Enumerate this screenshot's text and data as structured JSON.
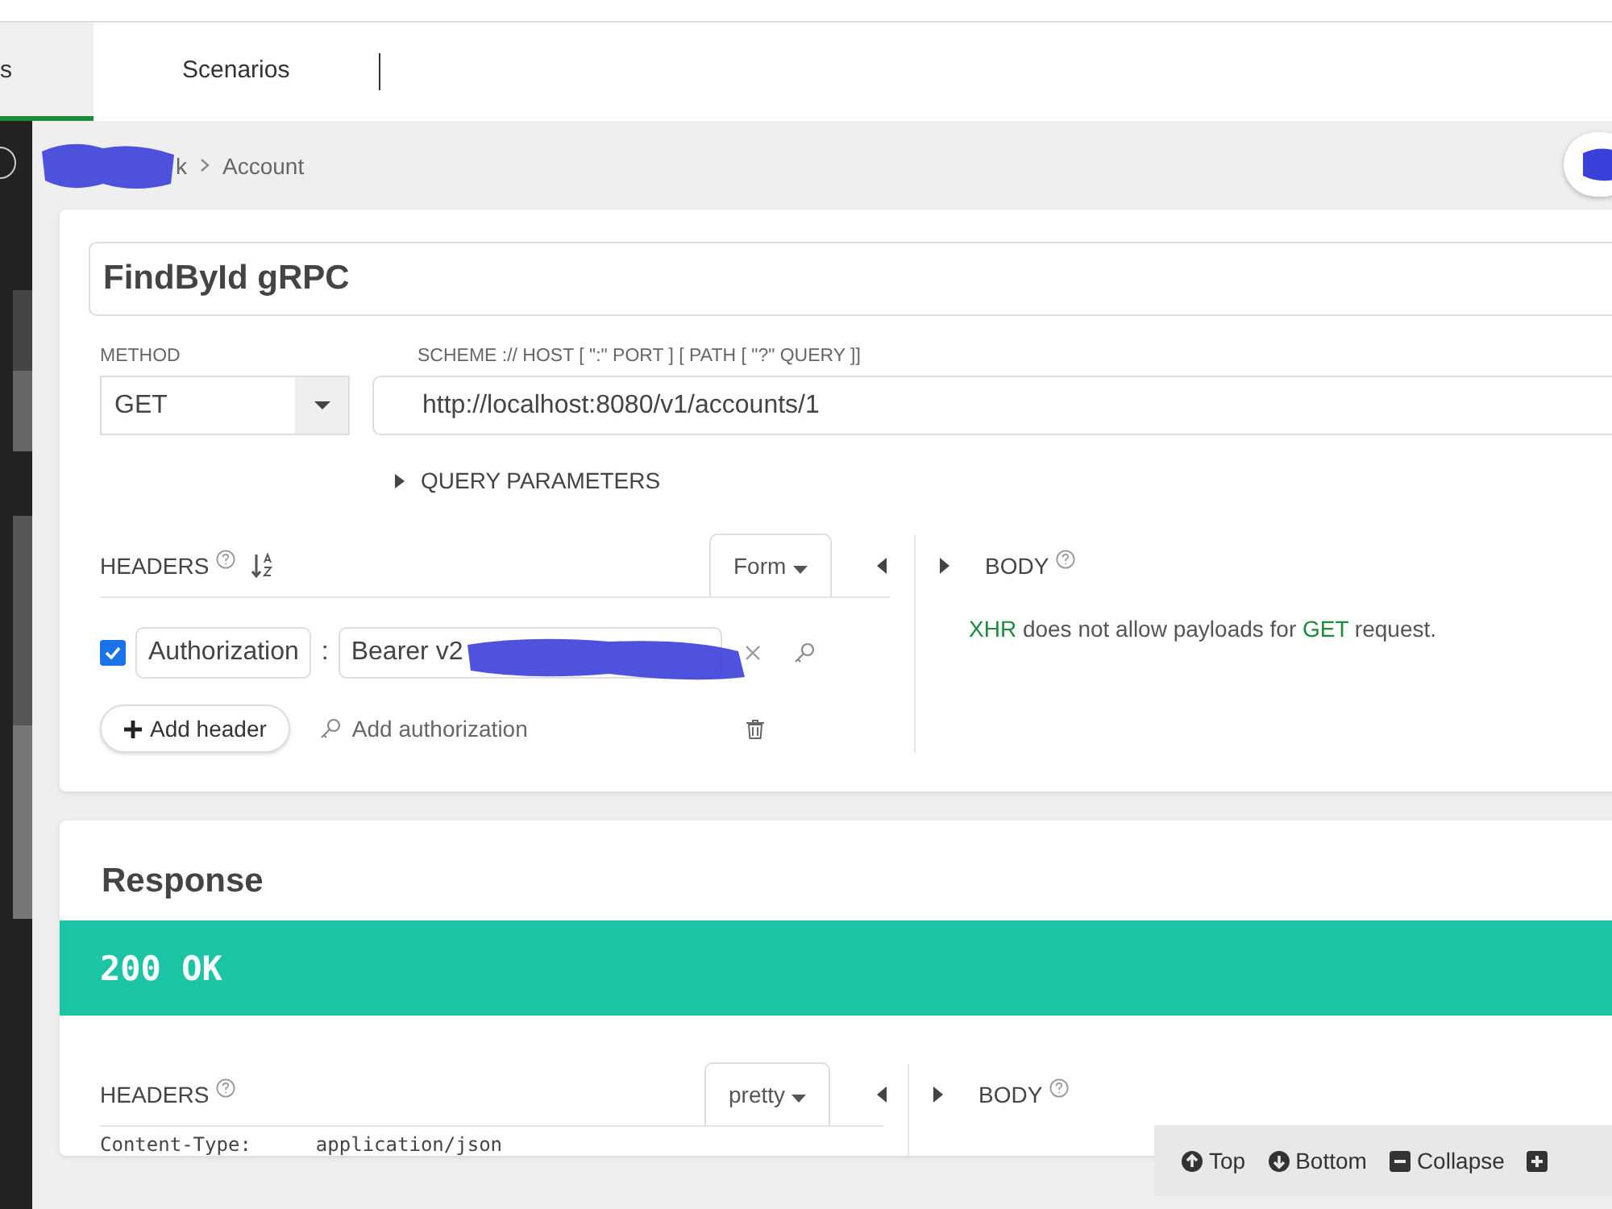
{
  "tabs": [
    {
      "label": "s",
      "selected": true
    },
    {
      "label": "Scenarios",
      "selected": false
    }
  ],
  "breadcrumb": [
    {
      "label": "k",
      "redacted": true
    },
    {
      "label": "Account",
      "redacted": false
    }
  ],
  "request": {
    "name": "FindById gRPC",
    "method_label": "METHOD",
    "method": "GET",
    "url_label": "SCHEME :// HOST [ \":\" PORT ] [ PATH [ \"?\" QUERY ]]",
    "url": "http://localhost:8080/v1/accounts/1",
    "query_toggle": {
      "label": "QUERY PARAMETERS",
      "expanded": false
    },
    "headers": {
      "title": "HEADERS",
      "mode": "Form",
      "rows": [
        {
          "checked": true,
          "name": "Authorization",
          "separator": ":",
          "value": "Bearer v2",
          "redacted": true
        }
      ],
      "add_header": "Add header",
      "add_auth": "Add authorization"
    },
    "body": {
      "title": "BODY",
      "message": [
        {
          "text": "XHR",
          "highlight": true
        },
        {
          "text": " does not allow payloads for ",
          "highlight": false
        },
        {
          "text": "GET",
          "highlight": true
        },
        {
          "text": " request.",
          "highlight": false
        }
      ]
    }
  },
  "response": {
    "title": "Response",
    "status": "200 OK",
    "headers": {
      "title": "HEADERS",
      "mode": "pretty",
      "rows": [
        {
          "name": "Content-Type:",
          "value": "application/json"
        }
      ]
    },
    "body": {
      "title": "BODY"
    }
  },
  "toolbar": [
    {
      "label": "Top",
      "kind": "up"
    },
    {
      "label": "Bottom",
      "kind": "down"
    },
    {
      "label": "Collapse",
      "kind": "collapse"
    },
    {
      "kind": "expand"
    }
  ]
}
